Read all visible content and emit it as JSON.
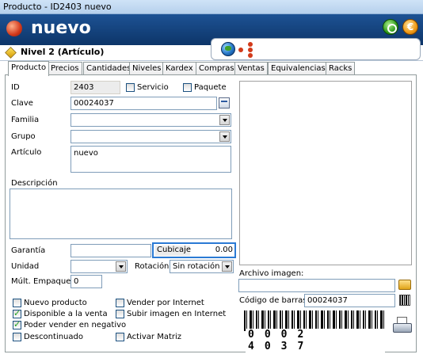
{
  "window": {
    "title": "Producto - ID2403 nuevo"
  },
  "header": {
    "title": "nuevo",
    "orange_button_label": "€"
  },
  "level": {
    "label": "Nivel 2 (Artículo)"
  },
  "tabs": [
    {
      "label": "Producto"
    },
    {
      "label": "Precios"
    },
    {
      "label": "Cantidades"
    },
    {
      "label": "Niveles"
    },
    {
      "label": "Kardex"
    },
    {
      "label": "Compras"
    },
    {
      "label": "Ventas"
    },
    {
      "label": "Equivalencias"
    },
    {
      "label": "Racks"
    }
  ],
  "form": {
    "id_label": "ID",
    "id_value": "2403",
    "servicio_label": "Servicio",
    "paquete_label": "Paquete",
    "clave_label": "Clave",
    "clave_value": "00024037",
    "familia_label": "Familia",
    "familia_value": "",
    "grupo_label": "Grupo",
    "grupo_value": "",
    "articulo_label": "Artículo",
    "articulo_value": "nuevo",
    "descripcion_label": "Descripción",
    "descripcion_value": "",
    "garantia_label": "Garantía",
    "garantia_value": "",
    "cubicaje_label": "Cubicaje",
    "cubicaje_value": "0.00",
    "unidad_label": "Unidad",
    "unidad_value": "",
    "rotacion_label": "Rotación",
    "rotacion_value": "Sin rotación",
    "mult_empaque_label": "Múlt. Empaque",
    "mult_empaque_value": "0"
  },
  "checkboxes": [
    {
      "label": "Nuevo producto",
      "checked": false
    },
    {
      "label": "Disponible a la venta",
      "checked": true
    },
    {
      "label": "Poder vender en negativo",
      "checked": true
    },
    {
      "label": "Descontinuado",
      "checked": false
    },
    {
      "label": "Vender por Internet",
      "checked": false
    },
    {
      "label": "Subir imagen en Internet",
      "checked": false
    },
    {
      "label": "Activar Matriz",
      "checked": false
    }
  ],
  "image": {
    "archivo_label": "Archivo imagen:",
    "archivo_value": "",
    "codigo_label": "Código de barras",
    "codigo_value": "00024037",
    "barcode_digits": "0002 4037"
  },
  "colors": {
    "header_bg": "#1d5294",
    "cubicaje_highlight": "#2a7ad4"
  }
}
